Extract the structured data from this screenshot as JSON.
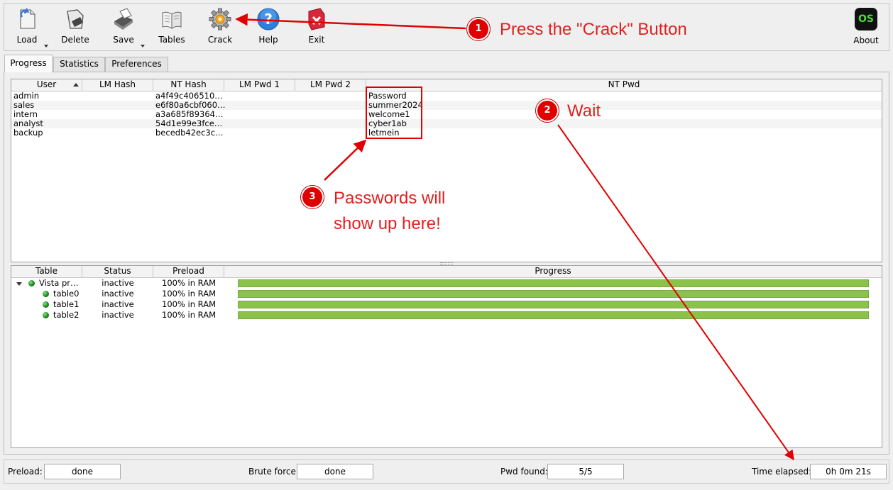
{
  "toolbar": {
    "buttons": [
      {
        "label": "Load",
        "icon": "load-icon"
      },
      {
        "label": "Delete",
        "icon": "delete-icon"
      },
      {
        "label": "Save",
        "icon": "save-icon"
      },
      {
        "label": "Tables",
        "icon": "tables-icon"
      },
      {
        "label": "Crack",
        "icon": "crack-icon"
      },
      {
        "label": "Help",
        "icon": "help-icon"
      },
      {
        "label": "Exit",
        "icon": "exit-icon"
      }
    ],
    "about": {
      "label": "About",
      "badge": "OS"
    }
  },
  "tabs": [
    {
      "label": "Progress",
      "active": true
    },
    {
      "label": "Statistics",
      "active": false
    },
    {
      "label": "Preferences",
      "active": false
    }
  ],
  "hash_table": {
    "columns": [
      "User",
      "LM Hash",
      "NT Hash",
      "LM Pwd 1",
      "LM Pwd 2",
      "NT Pwd"
    ],
    "rows": [
      {
        "user": "admin",
        "lm_hash": "",
        "nt_hash": "a4f49c406510…",
        "lm_pwd1": "",
        "lm_pwd2": "",
        "nt_pwd": "Password"
      },
      {
        "user": "sales",
        "lm_hash": "",
        "nt_hash": "e6f80a6cbf060…",
        "lm_pwd1": "",
        "lm_pwd2": "",
        "nt_pwd": "summer2024"
      },
      {
        "user": "intern",
        "lm_hash": "",
        "nt_hash": "a3a685f89364…",
        "lm_pwd1": "",
        "lm_pwd2": "",
        "nt_pwd": "welcome1"
      },
      {
        "user": "analyst",
        "lm_hash": "",
        "nt_hash": "54d1e99e3fce…",
        "lm_pwd1": "",
        "lm_pwd2": "",
        "nt_pwd": "cyber1ab"
      },
      {
        "user": "backup",
        "lm_hash": "",
        "nt_hash": "becedb42ec3c…",
        "lm_pwd1": "",
        "lm_pwd2": "",
        "nt_pwd": "letmein"
      }
    ]
  },
  "tables_grid": {
    "columns": [
      "Table",
      "Status",
      "Preload",
      "Progress"
    ],
    "rows": [
      {
        "name": "Vista pr…",
        "status": "inactive",
        "preload": "100% in RAM",
        "progress": 1.0,
        "level": 0
      },
      {
        "name": "table0",
        "status": "inactive",
        "preload": "100% in RAM",
        "progress": 1.0,
        "level": 1
      },
      {
        "name": "table1",
        "status": "inactive",
        "preload": "100% in RAM",
        "progress": 1.0,
        "level": 1
      },
      {
        "name": "table2",
        "status": "inactive",
        "preload": "100% in RAM",
        "progress": 1.0,
        "level": 1
      }
    ]
  },
  "statusbar": {
    "preload_label": "Preload:",
    "preload_value": "done",
    "brute_label": "Brute force:",
    "brute_value": "done",
    "pwd_label": "Pwd found:",
    "pwd_value": "5/5",
    "time_label": "Time elapsed:",
    "time_value": "0h 0m 21s"
  },
  "annotations": {
    "step1": {
      "number": "1",
      "text": "Press the \"Crack\" Button"
    },
    "step2": {
      "number": "2",
      "text": "Wait"
    },
    "step3": {
      "number": "3",
      "line1": "Passwords will",
      "line2": "show up here!"
    }
  },
  "colors": {
    "annotation_red": "#e00000",
    "progress_green": "#8bc34a",
    "status_dot": "#1a8a1a"
  }
}
